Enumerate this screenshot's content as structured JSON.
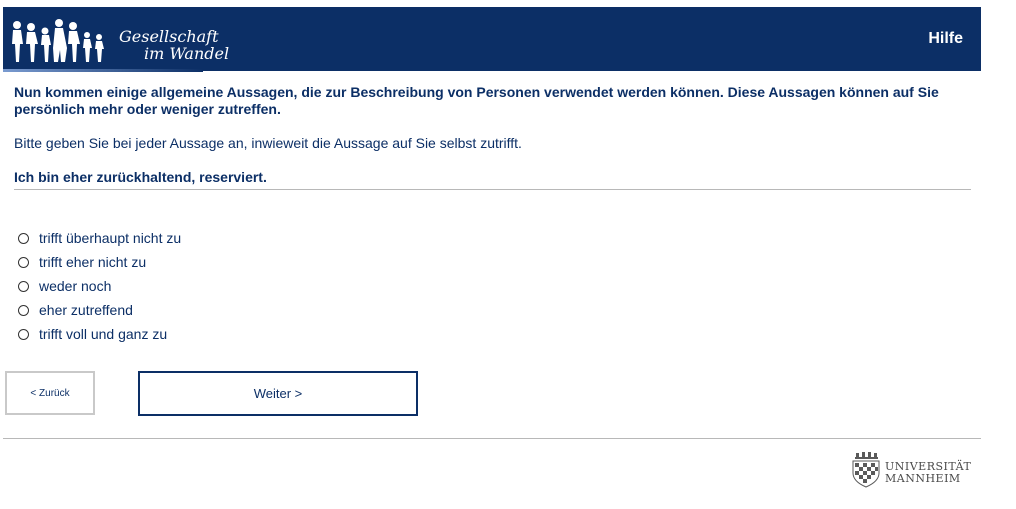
{
  "header": {
    "logo_line1": "Gesellschaft",
    "logo_line2": "im Wandel",
    "help_label": "Hilfe"
  },
  "intro_text": "Nun kommen einige allgemeine Aussagen, die zur Beschreibung von Personen verwendet werden können. Diese Aussagen können auf Sie persönlich mehr oder weniger zutreffen.",
  "instruction_text": "Bitte geben Sie bei jeder Aussage an, inwieweit die Aussage auf Sie selbst zutrifft.",
  "question_text": "Ich bin eher zurückhaltend, reserviert.",
  "options": [
    "trifft überhaupt nicht zu",
    "trifft eher nicht zu",
    "weder noch",
    "eher zutreffend",
    "trifft voll und ganz zu"
  ],
  "navigation": {
    "back_label": "< Zurück",
    "next_label": "Weiter >"
  },
  "footer": {
    "university_line1": "UNIVERSITÄT",
    "university_line2": "MANNHEIM"
  },
  "colors": {
    "primary": "#0c2f66",
    "rule": "#b8b8b8"
  }
}
